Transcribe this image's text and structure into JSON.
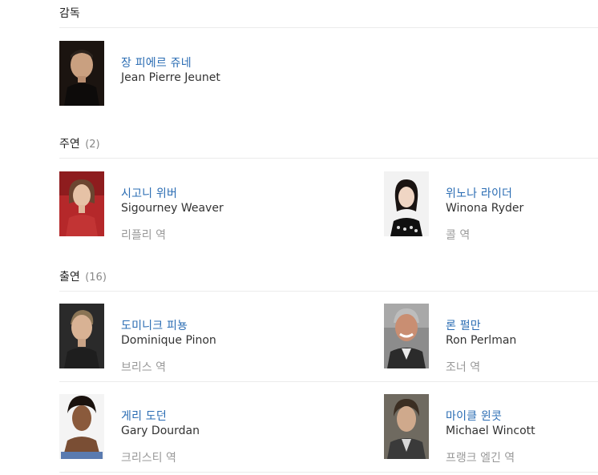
{
  "sections": {
    "director": {
      "title": "감독",
      "people": [
        {
          "name_ko": "장 피에르 쥬네",
          "name_en": "Jean Pierre Jeunet"
        }
      ]
    },
    "lead": {
      "title": "주연",
      "count": "(2)",
      "people": [
        {
          "name_ko": "시고니 위버",
          "name_en": "Sigourney Weaver",
          "role": "리플리 역"
        },
        {
          "name_ko": "위노나 라이더",
          "name_en": "Winona Ryder",
          "role": "콜 역"
        }
      ]
    },
    "cast": {
      "title": "출연",
      "count": "(16)",
      "people": [
        {
          "name_ko": "도미니크 피뇽",
          "name_en": "Dominique Pinon",
          "role": "브리스 역"
        },
        {
          "name_ko": "론 펄만",
          "name_en": "Ron Perlman",
          "role": "조너 역"
        },
        {
          "name_ko": "게리 도던",
          "name_en": "Gary Dourdan",
          "role": "크리스티 역"
        },
        {
          "name_ko": "마이클 윈콧",
          "name_en": "Michael Wincott",
          "role": "프랭크 엘긴 역"
        }
      ]
    }
  },
  "colors": {
    "link": "#2a6cb3",
    "muted": "#999999",
    "divider": "#ebebeb"
  }
}
